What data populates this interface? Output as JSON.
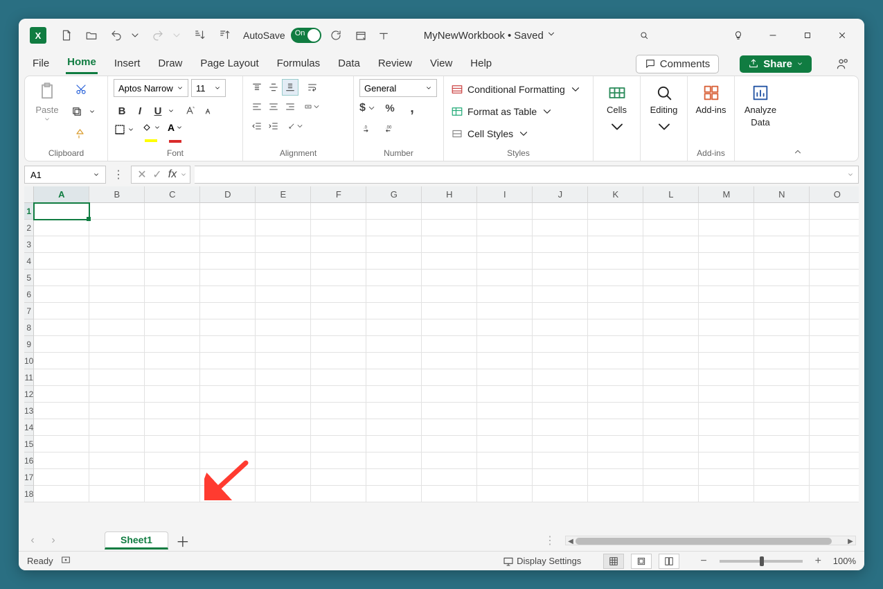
{
  "titlebar": {
    "autosave_label": "AutoSave",
    "autosave_state": "On",
    "filename": "MyNewWorkbook",
    "save_status": "Saved"
  },
  "tabs": {
    "file": "File",
    "home": "Home",
    "insert": "Insert",
    "draw": "Draw",
    "page_layout": "Page Layout",
    "formulas": "Formulas",
    "data": "Data",
    "review": "Review",
    "view": "View",
    "help": "Help",
    "comments": "Comments",
    "share": "Share"
  },
  "ribbon": {
    "clipboard": {
      "paste": "Paste",
      "group": "Clipboard"
    },
    "font": {
      "name": "Aptos Narrow",
      "size": "11",
      "group": "Font"
    },
    "alignment": {
      "group": "Alignment"
    },
    "number": {
      "format": "General",
      "group": "Number"
    },
    "styles": {
      "conditional": "Conditional Formatting",
      "table": "Format as Table",
      "cellstyles": "Cell Styles",
      "group": "Styles"
    },
    "cells": {
      "label": "Cells"
    },
    "editing": {
      "label": "Editing"
    },
    "addins": {
      "label": "Add-ins",
      "group": "Add-ins"
    },
    "analyze": {
      "label1": "Analyze",
      "label2": "Data"
    }
  },
  "formula_bar": {
    "name_box": "A1",
    "fx": "fx",
    "value": ""
  },
  "grid": {
    "columns": [
      "A",
      "B",
      "C",
      "D",
      "E",
      "F",
      "G",
      "H",
      "I",
      "J",
      "K",
      "L",
      "M",
      "N",
      "O"
    ],
    "rows": [
      1,
      2,
      3,
      4,
      5,
      6,
      7,
      8,
      9,
      10,
      11,
      12,
      13,
      14,
      15,
      16,
      17,
      18
    ],
    "selected_cell": "A1"
  },
  "sheettabs": {
    "tabs": [
      "Sheet1"
    ],
    "active": "Sheet1"
  },
  "statusbar": {
    "ready": "Ready",
    "display_settings": "Display Settings",
    "zoom": "100%"
  }
}
